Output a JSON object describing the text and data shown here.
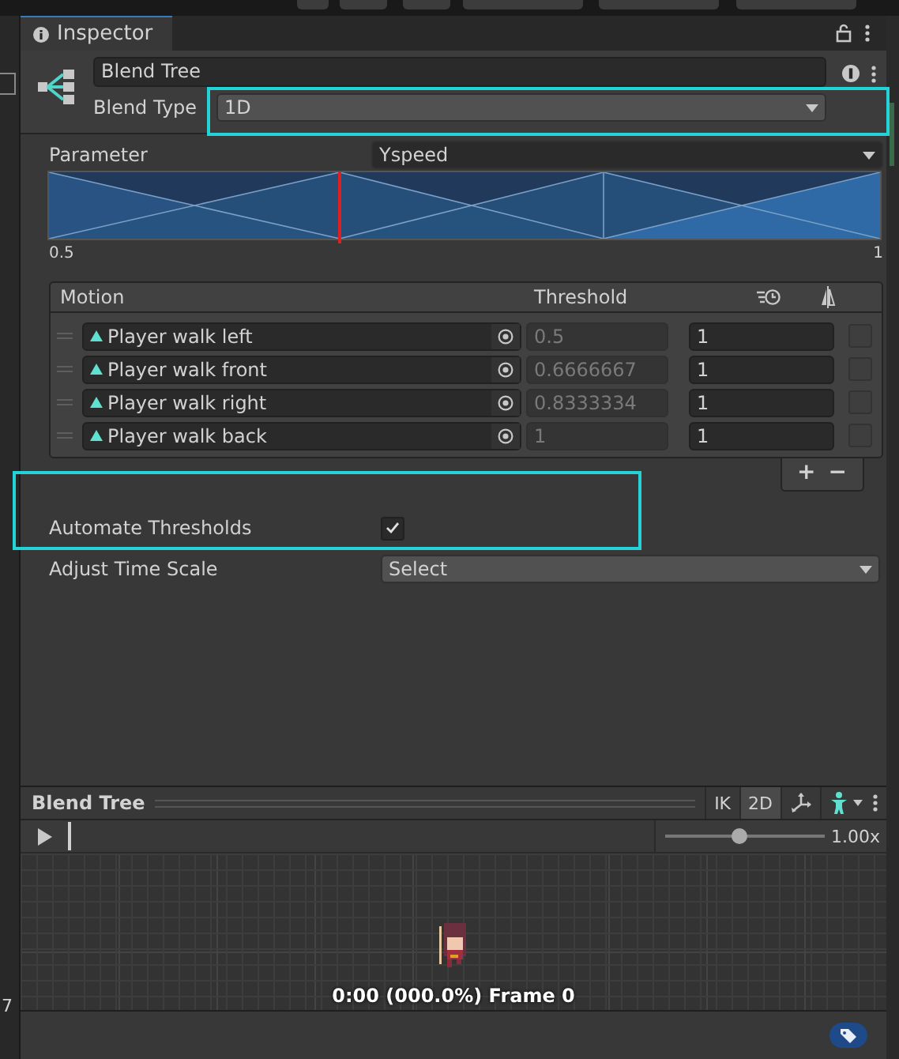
{
  "side_fragment": {
    "text": "7"
  },
  "inspector": {
    "tab": "Inspector",
    "name_field": {
      "value": "Blend Tree"
    },
    "blend_type": {
      "label": "Blend Type",
      "value": "1D",
      "highlighted": true
    },
    "parameter": {
      "label": "Parameter",
      "value": "Yspeed",
      "level": 0.35
    },
    "graph": {
      "min_label": "0.5",
      "max_label": "1"
    },
    "table": {
      "columns": [
        "Motion",
        "Threshold"
      ],
      "rows": [
        {
          "motion": "Player walk left",
          "threshold": "0.5",
          "time_scale": "1",
          "mirror": false
        },
        {
          "motion": "Player walk front",
          "threshold": "0.6666667",
          "time_scale": "1",
          "mirror": false
        },
        {
          "motion": "Player walk right",
          "threshold": "0.8333334",
          "time_scale": "1",
          "mirror": false
        },
        {
          "motion": "Player walk back",
          "threshold": "1",
          "time_scale": "1",
          "mirror": false
        }
      ],
      "add": "+",
      "remove": "−"
    },
    "automate": {
      "label": "Automate Thresholds",
      "checked": true,
      "highlighted": true
    },
    "adjust": {
      "label": "Adjust Time Scale",
      "value": "Select"
    }
  },
  "preview": {
    "title": "Blend Tree",
    "ik": "IK",
    "mode_2d": {
      "label": "2D",
      "selected": true
    },
    "speed": {
      "level": 0.47,
      "reading": "1.00x"
    },
    "caption": "0:00 (000.0%) Frame 0"
  }
}
